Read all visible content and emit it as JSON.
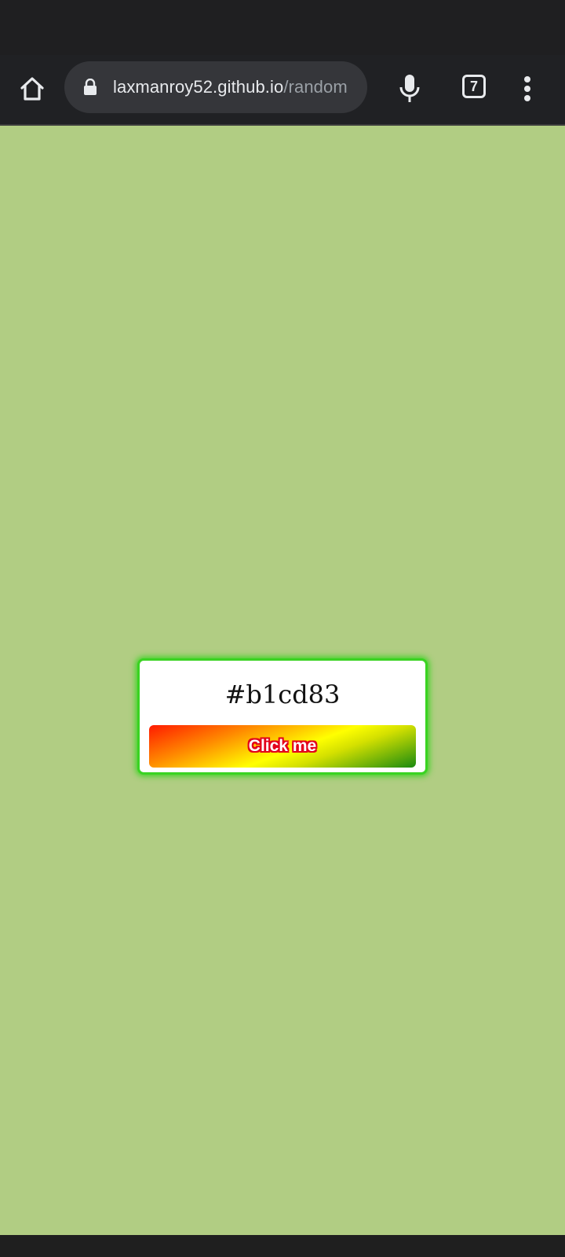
{
  "browser": {
    "url_host": "laxmanroy52.github.io",
    "url_path": "/random",
    "tab_count": "7",
    "icons": {
      "home": "home-icon",
      "lock": "lock-icon",
      "mic": "mic-icon",
      "tabs": "tab-switcher-icon",
      "menu": "overflow-menu-icon"
    }
  },
  "page": {
    "background_color": "#b1cd83",
    "color_code": "#b1cd83",
    "button_label": "Click me",
    "card_glow_color": "#3ad322"
  }
}
